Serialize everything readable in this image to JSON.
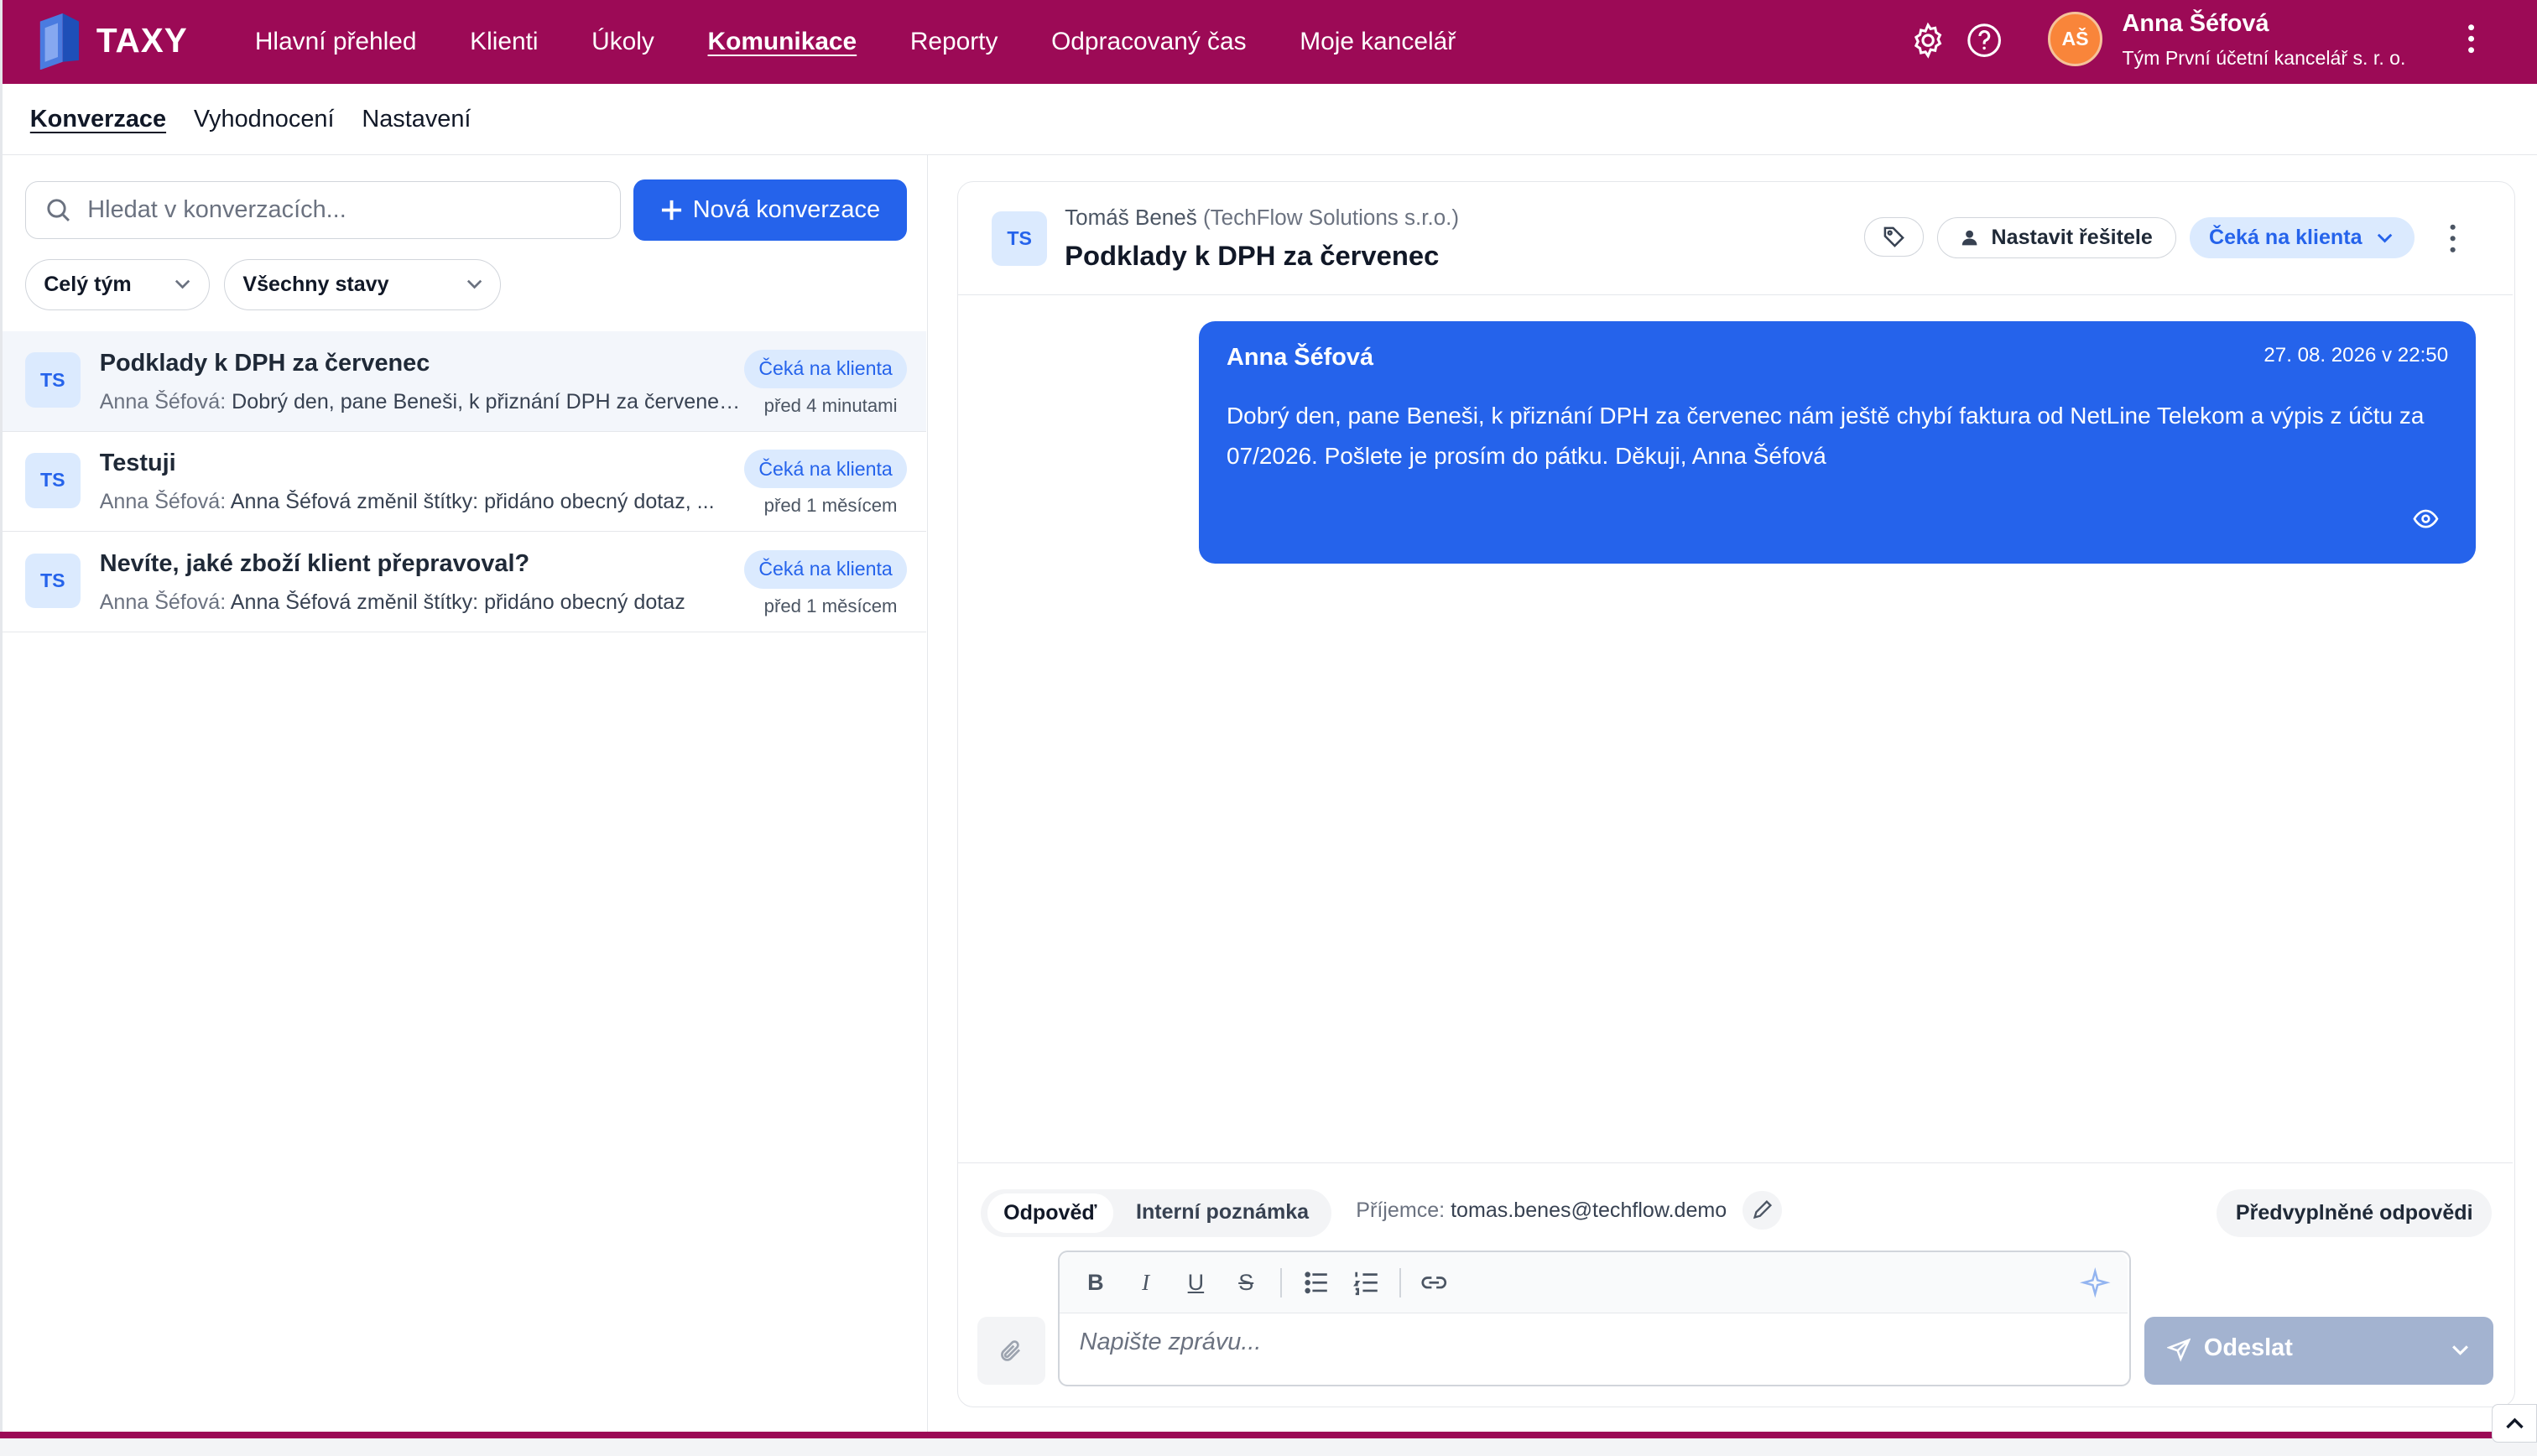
{
  "app": {
    "brand": "TAXY",
    "nav": [
      "Hlavní přehled",
      "Klienti",
      "Úkoly",
      "Komunikace",
      "Reporty",
      "Odpracovaný čas",
      "Moje kancelář"
    ],
    "active_nav": "Komunikace",
    "user": {
      "initials": "AŠ",
      "name": "Anna Šéfová",
      "team": "Tým První účetní kancelář s. r. o."
    },
    "icons": [
      "settings-icon",
      "help-icon",
      "more-vertical-icon"
    ],
    "colors": {
      "brand": "#9c0a56",
      "accent": "#2563eb",
      "avatar": "#f9853a"
    }
  },
  "subnav": {
    "items": [
      "Konverzace",
      "Vyhodnocení",
      "Nastavení"
    ],
    "active": "Konverzace"
  },
  "sidebar": {
    "search_placeholder": "Hledat v konverzacích...",
    "new_button": "Nová konverzace",
    "filters": [
      "Celý tým",
      "Všechny stavy"
    ],
    "conversations": [
      {
        "initials": "TS",
        "title": "Podklady k DPH za červenec",
        "author": "Anna Šéfová:",
        "preview": "Dobrý den, pane Beneši, k přiznání DPH za červenec nám ještě chybí faktura od NetLine Telekom a výpis z účtu za 07/2026.",
        "status": "Čeká na klienta",
        "time": "před 4 minutami",
        "selected": true
      },
      {
        "initials": "TS",
        "title": "Testuji",
        "author": "Anna Šéfová:",
        "preview": "Anna Šéfová změnil štítky: přidáno obecný dotaz, ...",
        "status": "Čeká na klienta",
        "time": "před 1 měsícem",
        "selected": false
      },
      {
        "initials": "TS",
        "title": "Nevíte, jaké zboží klient přepravoval?",
        "author": "Anna Šéfová:",
        "preview": "Anna Šéfová změnil štítky: přidáno obecný dotaz",
        "status": "Čeká na klienta",
        "time": "před 1 měsícem",
        "selected": false
      }
    ]
  },
  "conversation": {
    "initials": "TS",
    "contact": "Tomáš Beneš",
    "company": "(TechFlow Solutions s.r.o.)",
    "subject": "Podklady k DPH za červenec",
    "assign_label": "Nastavit řešitele",
    "status": "Čeká na klienta",
    "messages": [
      {
        "author": "Anna Šéfová",
        "date": "27. 08. 2026 v 22:50",
        "body": "Dobrý den, pane Beneši, k přiznání DPH za červenec nám ještě chybí faktura od NetLine Telekom a výpis z účtu za 07/2026. Pošlete je prosím do pátku. Děkuji, Anna Šéfová"
      }
    ]
  },
  "composer": {
    "modes": [
      "Odpověď",
      "Interní poznámka"
    ],
    "active_mode": "Odpověď",
    "recipient_label": "Příjemce:",
    "recipient_email": "tomas.benes@techflow.demo",
    "prefilled_label": "Předvyplněné odpovědi",
    "placeholder": "Napište zprávu...",
    "send_label": "Odeslat"
  }
}
